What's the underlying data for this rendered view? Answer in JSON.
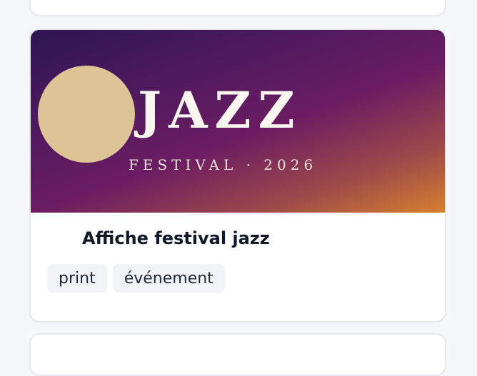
{
  "card": {
    "cover": {
      "title": "JAZZ",
      "subtitle": "FESTIVAL · 2026"
    },
    "title": "Affiche festival jazz",
    "tags": [
      "print",
      "événement"
    ]
  },
  "colors": {
    "background": "#f6f7fa",
    "card_border": "#e5e7eb",
    "gradient_start": "#2d1552",
    "gradient_end": "#d6802e",
    "moon": "#ddc496",
    "tag_bg": "#f1f3f6"
  }
}
